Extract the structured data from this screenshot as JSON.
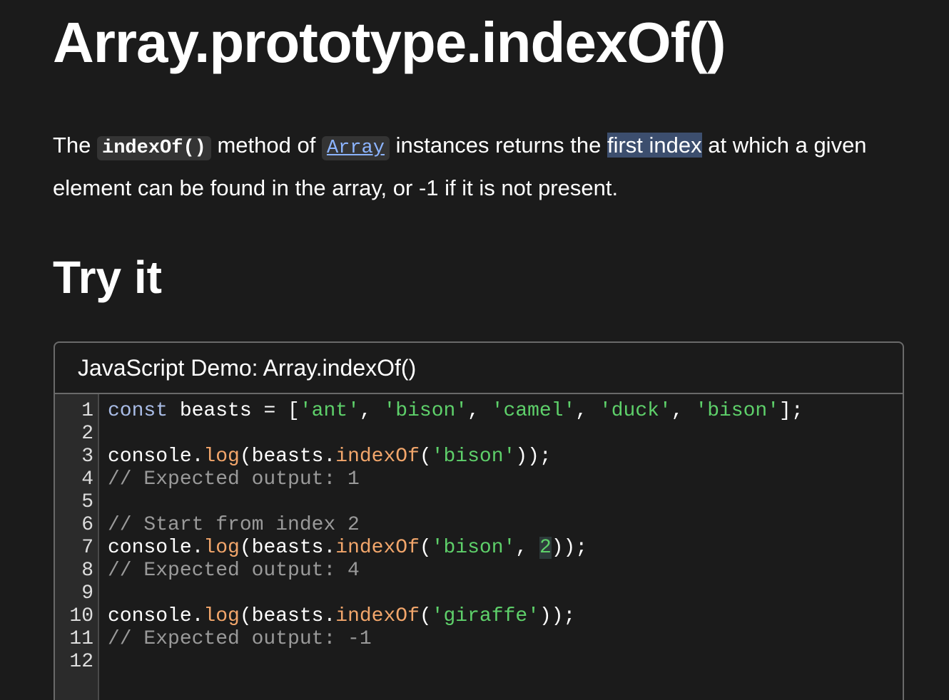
{
  "title": "Array.prototype.indexOf()",
  "intro": {
    "t1": "The ",
    "code1": "indexOf()",
    "t2": " method of ",
    "link": "Array",
    "t3": " instances returns the ",
    "highlight": "first index",
    "t4": " at which a given element can be found in the array, or -1 if it is not present."
  },
  "try_heading": "Try it",
  "demo": {
    "title": "JavaScript Demo: Array.indexOf()",
    "lines": [
      [
        [
          "kw",
          "const"
        ],
        [
          "plain",
          " beasts = ["
        ],
        [
          "str",
          "'ant'"
        ],
        [
          "plain",
          ", "
        ],
        [
          "str",
          "'bison'"
        ],
        [
          "plain",
          ", "
        ],
        [
          "str",
          "'camel'"
        ],
        [
          "plain",
          ", "
        ],
        [
          "str",
          "'duck'"
        ],
        [
          "plain",
          ", "
        ],
        [
          "str",
          "'bison'"
        ],
        [
          "plain",
          "];"
        ]
      ],
      [],
      [
        [
          "plain",
          "console."
        ],
        [
          "fn",
          "log"
        ],
        [
          "plain",
          "(beasts."
        ],
        [
          "fn",
          "indexOf"
        ],
        [
          "plain",
          "("
        ],
        [
          "str",
          "'bison'"
        ],
        [
          "plain",
          "));"
        ]
      ],
      [
        [
          "cm",
          "// Expected output: 1"
        ]
      ],
      [],
      [
        [
          "cm",
          "// Start from index 2"
        ]
      ],
      [
        [
          "plain",
          "console."
        ],
        [
          "fn",
          "log"
        ],
        [
          "plain",
          "(beasts."
        ],
        [
          "fn",
          "indexOf"
        ],
        [
          "plain",
          "("
        ],
        [
          "str",
          "'bison'"
        ],
        [
          "plain",
          ", "
        ],
        [
          "num",
          "2"
        ],
        [
          "plain",
          "));"
        ]
      ],
      [
        [
          "cm",
          "// Expected output: 4"
        ]
      ],
      [],
      [
        [
          "plain",
          "console."
        ],
        [
          "fn",
          "log"
        ],
        [
          "plain",
          "(beasts."
        ],
        [
          "fn",
          "indexOf"
        ],
        [
          "plain",
          "("
        ],
        [
          "str",
          "'giraffe'"
        ],
        [
          "plain",
          "));"
        ]
      ],
      [
        [
          "cm",
          "// Expected output: -1"
        ]
      ],
      []
    ]
  }
}
